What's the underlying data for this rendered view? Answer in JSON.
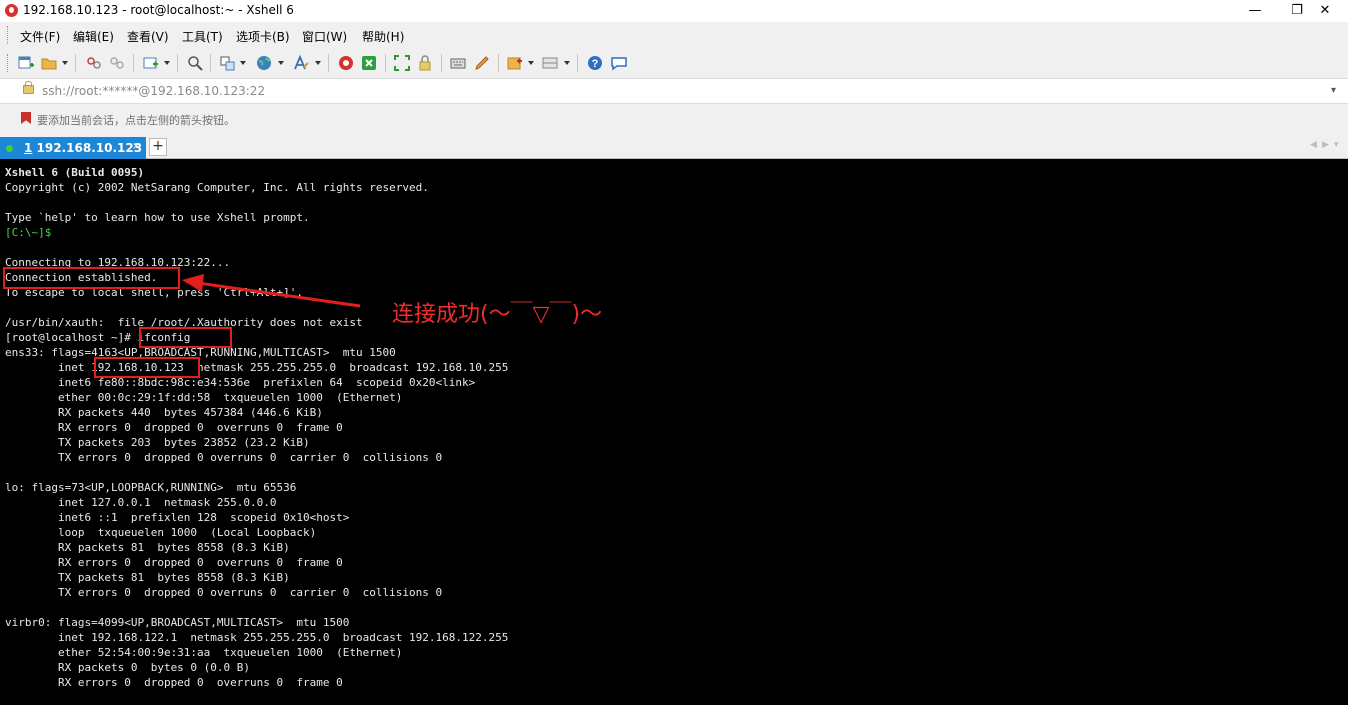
{
  "window": {
    "title": "192.168.10.123 - root@localhost:~ - Xshell 6"
  },
  "window_controls": {
    "minimize": "—",
    "maximize": "❐",
    "close": "✕"
  },
  "menu": [
    "文件(F)",
    "编辑(E)",
    "查看(V)",
    "工具(T)",
    "选项卡(B)",
    "窗口(W)",
    "帮助(H)"
  ],
  "address": {
    "value": "ssh://root:******@192.168.10.123:22",
    "dropdown": "▾"
  },
  "hint": "要添加当前会话，点击左侧的箭头按钮。",
  "tab": {
    "number": "1",
    "label": "192.168.10.123",
    "close": "×",
    "add": "+",
    "prev": "◀",
    "next": "▶",
    "menu": "▾"
  },
  "terminal": {
    "lines": [
      "Xshell 6 (Build 0095)",
      "Copyright (c) 2002 NetSarang Computer, Inc. All rights reserved.",
      "",
      "Type `help' to learn how to use Xshell prompt.",
      "[C:\\~]$",
      "",
      "Connecting to 192.168.10.123:22...",
      "Connection established.",
      "To escape to local shell, press 'Ctrl+Alt+]'.",
      "",
      "/usr/bin/xauth:  file /root/.Xauthority does not exist",
      "[root@localhost ~]# ifconfig",
      "ens33: flags=4163<UP,BROADCAST,RUNNING,MULTICAST>  mtu 1500",
      "        inet 192.168.10.123  netmask 255.255.255.0  broadcast 192.168.10.255",
      "        inet6 fe80::8bdc:98c:e34:536e  prefixlen 64  scopeid 0x20<link>",
      "        ether 00:0c:29:1f:dd:58  txqueuelen 1000  (Ethernet)",
      "        RX packets 440  bytes 457384 (446.6 KiB)",
      "        RX errors 0  dropped 0  overruns 0  frame 0",
      "        TX packets 203  bytes 23852 (23.2 KiB)",
      "        TX errors 0  dropped 0 overruns 0  carrier 0  collisions 0",
      "",
      "lo: flags=73<UP,LOOPBACK,RUNNING>  mtu 65536",
      "        inet 127.0.0.1  netmask 255.0.0.0",
      "        inet6 ::1  prefixlen 128  scopeid 0x10<host>",
      "        loop  txqueuelen 1000  (Local Loopback)",
      "        RX packets 81  bytes 8558 (8.3 KiB)",
      "        RX errors 0  dropped 0  overruns 0  frame 0",
      "        TX packets 81  bytes 8558 (8.3 KiB)",
      "        TX errors 0  dropped 0 overruns 0  carrier 0  collisions 0",
      "",
      "virbr0: flags=4099<UP,BROADCAST,MULTICAST>  mtu 1500",
      "        inet 192.168.122.1  netmask 255.255.255.0  broadcast 192.168.122.255",
      "        ether 52:54:00:9e:31:aa  txqueuelen 1000  (Ethernet)",
      "        RX packets 0  bytes 0 (0.0 B)",
      "        RX errors 0  dropped 0  overruns 0  frame 0"
    ]
  },
  "annotation": {
    "text": "连接成功(～￣▽￣)～"
  },
  "colors": {
    "tab_active": "#1e86d6",
    "annotation_red": "#e0201c",
    "prompt_green": "#4fd34f",
    "terminal_bg": "#000000"
  }
}
